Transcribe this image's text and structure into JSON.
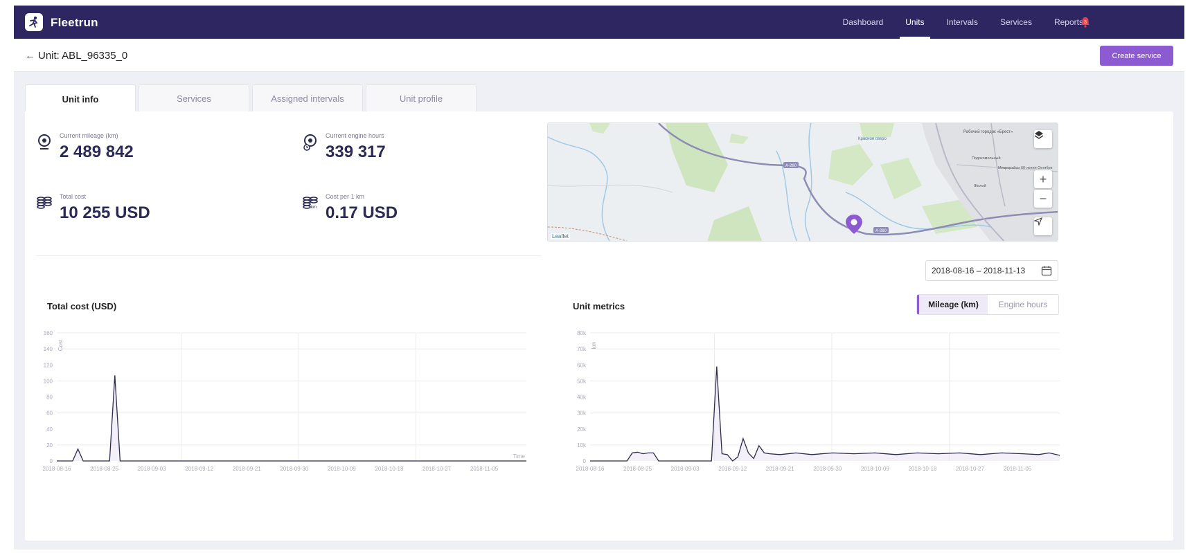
{
  "app": {
    "brand": "Fleetrun"
  },
  "nav": {
    "items": [
      {
        "label": "Dashboard",
        "active": false
      },
      {
        "label": "Units",
        "active": true
      },
      {
        "label": "Intervals",
        "active": false
      },
      {
        "label": "Services",
        "active": false
      },
      {
        "label": "Reports",
        "active": false
      }
    ],
    "notifications_count": "3"
  },
  "header": {
    "title": "Unit: ABL_96335_0",
    "create_button": "Create service"
  },
  "tabs": [
    {
      "label": "Unit info",
      "active": true
    },
    {
      "label": "Services",
      "active": false
    },
    {
      "label": "Assigned intervals",
      "active": false
    },
    {
      "label": "Unit profile",
      "active": false
    }
  ],
  "stats": {
    "mileage": {
      "label": "Current mileage (km)",
      "value": "2 489 842"
    },
    "engine_hours": {
      "label": "Current engine hours",
      "value": "339 317"
    },
    "total_cost": {
      "label": "Total cost",
      "value": "10 255 USD"
    },
    "cost_per_km": {
      "label": "Cost per 1 km",
      "value": "0.17 USD"
    }
  },
  "map": {
    "attribution": "Leaflet",
    "road_label": "A-260",
    "place_labels": [
      "Красное озеро",
      "Рабочий городок «Брест»",
      "Подокомольный",
      "Микрорайон 60-летия Октября",
      "Жилой"
    ]
  },
  "date_range": "2018-08-16 – 2018-11-13",
  "metric_toggle": {
    "mileage": "Mileage (km)",
    "engine_hours": "Engine hours",
    "selected": "mileage"
  },
  "chart_data": [
    {
      "type": "line",
      "title": "Total cost (USD)",
      "ylabel": "Cost",
      "xlabel": "Time",
      "ylim": [
        0,
        160
      ],
      "yticks": [
        "0",
        "20",
        "40",
        "60",
        "80",
        "100",
        "120",
        "140",
        "160"
      ],
      "xticks": [
        "2018-08-16",
        "2018-08-25",
        "2018-09-03",
        "2018-09-12",
        "2018-09-21",
        "2018-09-30",
        "2018-10-09",
        "2018-10-18",
        "2018-10-27",
        "2018-11-05"
      ],
      "series": [
        {
          "points": [
            [
              "2018-08-16",
              0
            ],
            [
              "2018-08-19",
              0
            ],
            [
              "2018-08-20",
              15
            ],
            [
              "2018-08-21",
              0
            ],
            [
              "2018-08-26",
              0
            ],
            [
              "2018-08-27",
              107
            ],
            [
              "2018-08-28",
              0
            ],
            [
              "2018-11-13",
              0
            ]
          ]
        }
      ]
    },
    {
      "type": "line",
      "title": "Unit metrics",
      "ylabel": "km",
      "ylim": [
        0,
        80000
      ],
      "yticks": [
        "0",
        "10k",
        "20k",
        "30k",
        "40k",
        "50k",
        "60k",
        "70k",
        "80k"
      ],
      "xticks": [
        "2018-08-16",
        "2018-08-25",
        "2018-09-03",
        "2018-09-12",
        "2018-09-21",
        "2018-09-30",
        "2018-10-09",
        "2018-10-18",
        "2018-10-27",
        "2018-11-05"
      ],
      "series": [
        {
          "points": [
            [
              "2018-08-16",
              0
            ],
            [
              "2018-08-23",
              0
            ],
            [
              "2018-08-24",
              5000
            ],
            [
              "2018-08-25",
              5500
            ],
            [
              "2018-08-26",
              4500
            ],
            [
              "2018-08-27",
              5000
            ],
            [
              "2018-08-28",
              5000
            ],
            [
              "2018-08-29",
              0
            ],
            [
              "2018-09-08",
              0
            ],
            [
              "2018-09-09",
              59000
            ],
            [
              "2018-09-10",
              4500
            ],
            [
              "2018-09-11",
              4000
            ],
            [
              "2018-09-12",
              0
            ],
            [
              "2018-09-13",
              2500
            ],
            [
              "2018-09-14",
              14000
            ],
            [
              "2018-09-15",
              5000
            ],
            [
              "2018-09-16",
              1500
            ],
            [
              "2018-09-17",
              9500
            ],
            [
              "2018-09-18",
              5000
            ],
            [
              "2018-09-19",
              4500
            ],
            [
              "2018-09-21",
              4000
            ],
            [
              "2018-09-24",
              5000
            ],
            [
              "2018-09-27",
              4000
            ],
            [
              "2018-10-01",
              5000
            ],
            [
              "2018-10-05",
              4500
            ],
            [
              "2018-10-09",
              5000
            ],
            [
              "2018-10-13",
              4000
            ],
            [
              "2018-10-17",
              5000
            ],
            [
              "2018-10-21",
              4500
            ],
            [
              "2018-10-25",
              5000
            ],
            [
              "2018-10-29",
              4000
            ],
            [
              "2018-11-02",
              5000
            ],
            [
              "2018-11-06",
              4500
            ],
            [
              "2018-11-09",
              4000
            ],
            [
              "2018-11-11",
              5000
            ],
            [
              "2018-11-13",
              3500
            ]
          ]
        }
      ]
    }
  ],
  "colors": {
    "navbar": "#2e2660",
    "accent": "#8c5bd1",
    "line": "#2b2b4a"
  }
}
